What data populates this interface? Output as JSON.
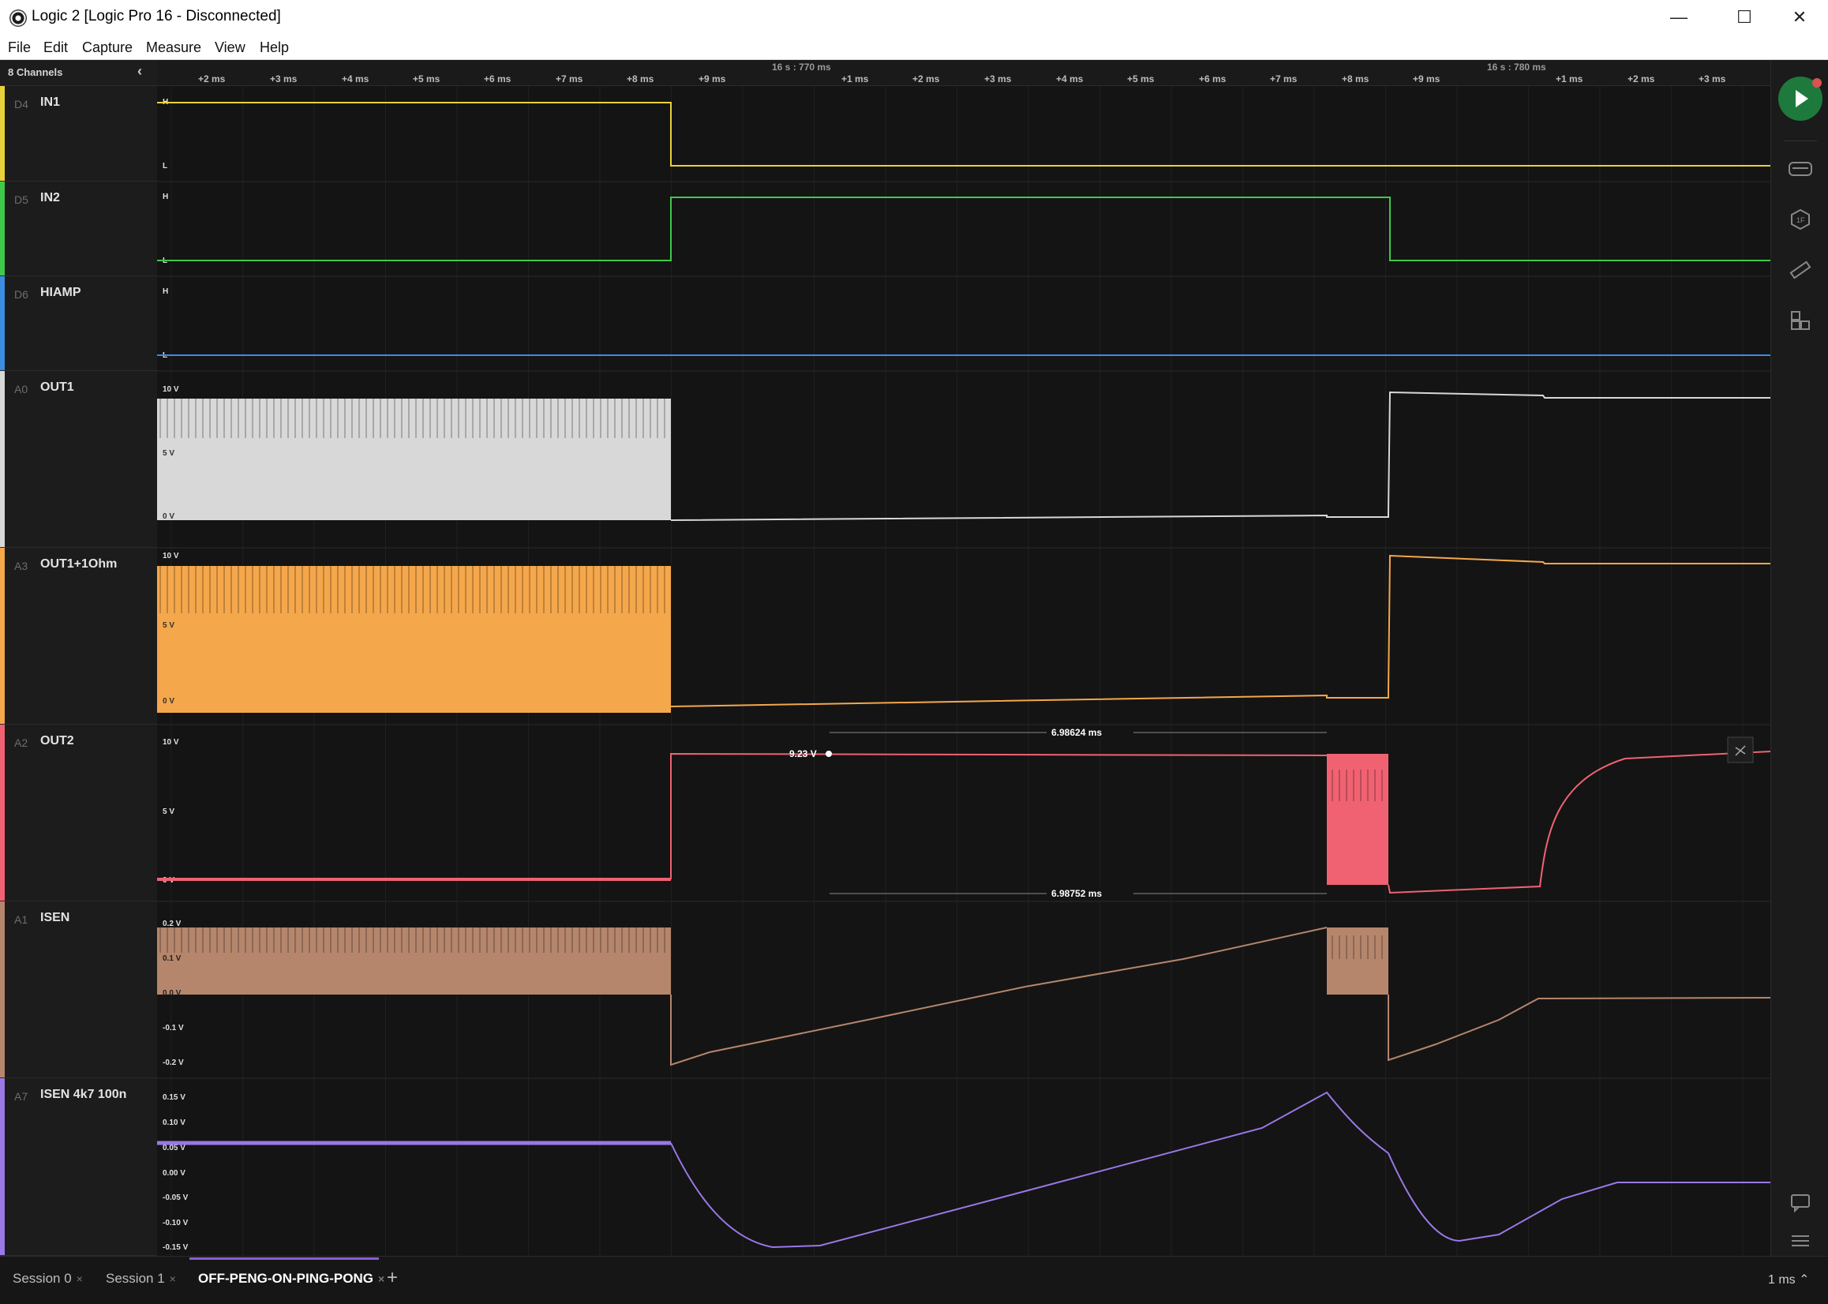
{
  "window": {
    "title": "Logic 2 [Logic Pro 16 - Disconnected]",
    "minimize_glyph": "—",
    "maximize_glyph": "☐",
    "close_glyph": "✕"
  },
  "menu": {
    "items": [
      "File",
      "Edit",
      "Capture",
      "Measure",
      "View",
      "Help"
    ]
  },
  "sidebar": {
    "channel_count": "8 Channels",
    "collapse_icon": "chevron-left-icon"
  },
  "ruler": {
    "ticks": [
      "+2 ms",
      "+3 ms",
      "+4 ms",
      "+5 ms",
      "+6 ms",
      "+7 ms",
      "+8 ms",
      "+9 ms",
      "+1 ms",
      "+2 ms",
      "+3 ms",
      "+4 ms",
      "+5 ms",
      "+6 ms",
      "+7 ms",
      "+8 ms",
      "+9 ms",
      "+1 ms",
      "+2 ms",
      "+3 ms"
    ],
    "major": [
      "16 s : 770 ms",
      "16 s : 780 ms"
    ]
  },
  "channels": [
    {
      "id": "D4",
      "name": "IN1",
      "color": "#e8d23a",
      "type": "digital"
    },
    {
      "id": "D5",
      "name": "IN2",
      "color": "#3ec94a",
      "type": "digital"
    },
    {
      "id": "D6",
      "name": "HIAMP",
      "color": "#3a8de0",
      "type": "digital"
    },
    {
      "id": "A0",
      "name": "OUT1",
      "color": "#d8d8d8",
      "type": "analog",
      "scale": [
        "10 V",
        "5 V",
        "0 V"
      ]
    },
    {
      "id": "A3",
      "name": "OUT1+1Ohm",
      "color": "#f5a74b",
      "type": "analog",
      "scale": [
        "10 V",
        "5 V",
        "0 V"
      ]
    },
    {
      "id": "A2",
      "name": "OUT2",
      "color": "#f06272",
      "type": "analog",
      "scale": [
        "10 V",
        "5 V",
        "0 V"
      ]
    },
    {
      "id": "A1",
      "name": "ISEN",
      "color": "#b5866c",
      "type": "analog",
      "scale": [
        "0.2 V",
        "0.1 V",
        "0.0 V",
        "-0.1 V",
        "-0.2 V"
      ]
    },
    {
      "id": "A7",
      "name": "ISEN 4k7 100n",
      "color": "#9a78e6",
      "type": "analog",
      "scale": [
        "0.15 V",
        "0.10 V",
        "0.05 V",
        "0.00 V",
        "-0.05 V",
        "-0.10 V",
        "-0.15 V"
      ]
    }
  ],
  "digital_levels": {
    "high": "H",
    "low": "L"
  },
  "measurements": {
    "width_top": "6.98624 ms",
    "width_bottom": "6.98752 ms",
    "marker_value": "9.23 V"
  },
  "toolbar": {
    "items": [
      "play-icon",
      "analyzers-icon",
      "extensions-icon",
      "measure-icon",
      "timing-markers-icon",
      "notes-icon",
      "settings-menu-icon"
    ]
  },
  "tabs": [
    {
      "label": "Session 0",
      "active": false
    },
    {
      "label": "Session 1",
      "active": false
    },
    {
      "label": "OFF-PENG-ON-PING-PONG",
      "active": true
    }
  ],
  "tab_close_glyph": "×",
  "add_tab_glyph": "+",
  "zoom": {
    "label": "1 ms ⌃"
  }
}
